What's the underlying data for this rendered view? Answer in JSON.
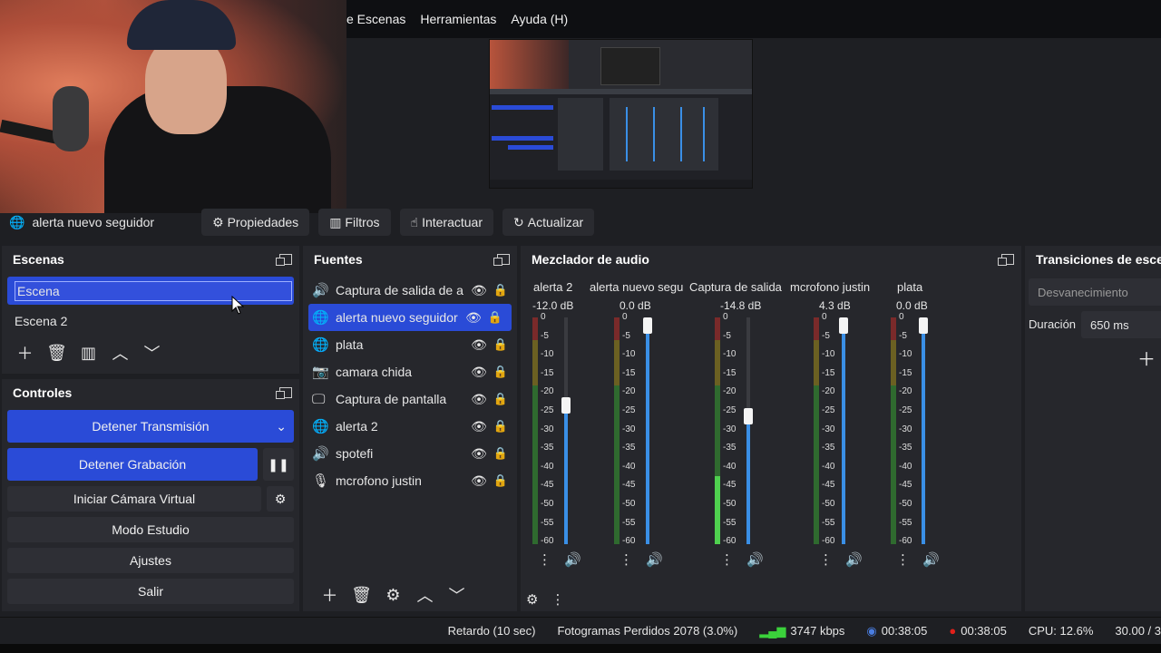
{
  "menu": {
    "items": [
      "e Escenas",
      "Herramientas",
      "Ayuda (H)"
    ]
  },
  "context_bar": {
    "source_name": "alerta nuevo seguidor",
    "buttons": [
      "Propiedades",
      "Filtros",
      "Interactuar",
      "Actualizar"
    ]
  },
  "scenes": {
    "title": "Escenas",
    "items": [
      "Escena",
      "Escena 2"
    ],
    "selected": "Escena"
  },
  "controls": {
    "title": "Controles",
    "stop_stream": "Detener Transmisión",
    "stop_record": "Detener Grabación",
    "virtual_cam": "Iniciar Cámara Virtual",
    "studio_mode": "Modo Estudio",
    "settings": "Ajustes",
    "exit": "Salir"
  },
  "sources": {
    "title": "Fuentes",
    "items": [
      {
        "label": "Captura de salida de a",
        "icon": "speaker-icon",
        "locked": false
      },
      {
        "label": "alerta nuevo seguidor",
        "icon": "globe-icon",
        "locked": true,
        "selected": true
      },
      {
        "label": "plata",
        "icon": "globe-icon",
        "locked": true
      },
      {
        "label": "camara chida",
        "icon": "camera-icon",
        "locked": true
      },
      {
        "label": "Captura de pantalla",
        "icon": "monitor-icon",
        "locked": false
      },
      {
        "label": "alerta 2",
        "icon": "globe-icon",
        "locked": true
      },
      {
        "label": "spotefi",
        "icon": "speaker-icon",
        "locked": false
      },
      {
        "label": "mcrofono justin",
        "icon": "mic-icon",
        "locked": false
      }
    ]
  },
  "mixer": {
    "title": "Mezclador de audio",
    "ticks": [
      "0",
      "-5",
      "-10",
      "-15",
      "-20",
      "-25",
      "-30",
      "-35",
      "-40",
      "-45",
      "-50",
      "-55",
      "-60"
    ],
    "channels": [
      {
        "name": "alerta 2",
        "db": "-12.0 dB",
        "fader": 0.62,
        "level": 0.0
      },
      {
        "name": "alerta nuevo segu",
        "db": "0.0 dB",
        "fader": 1.0,
        "level": 0.0
      },
      {
        "name": "Captura de salida",
        "db": "-14.8 dB",
        "fader": 0.57,
        "level": 0.3
      },
      {
        "name": "mcrofono justin",
        "db": "4.3 dB",
        "fader": 1.0,
        "level": 0.0
      },
      {
        "name": "plata",
        "db": "0.0 dB",
        "fader": 1.0,
        "level": 0.0
      }
    ]
  },
  "transitions": {
    "title": "Transiciones de esce",
    "type": "Desvanecimiento",
    "duration_label": "Duración",
    "duration_value": "650 ms"
  },
  "status": {
    "delay": "Retardo (10 sec)",
    "dropped": "Fotogramas Perdidos 2078 (3.0%)",
    "bitrate": "3747 kbps",
    "stream_time": "00:38:05",
    "rec_time": "00:38:05",
    "cpu": "CPU: 12.6%",
    "fps": "30.00 / 3"
  },
  "colors": {
    "accent": "#2a4bd7",
    "bg": "#1e1f23",
    "panel": "#26272c",
    "rec": "#e0201a",
    "bitrate": "#3bd13b"
  }
}
